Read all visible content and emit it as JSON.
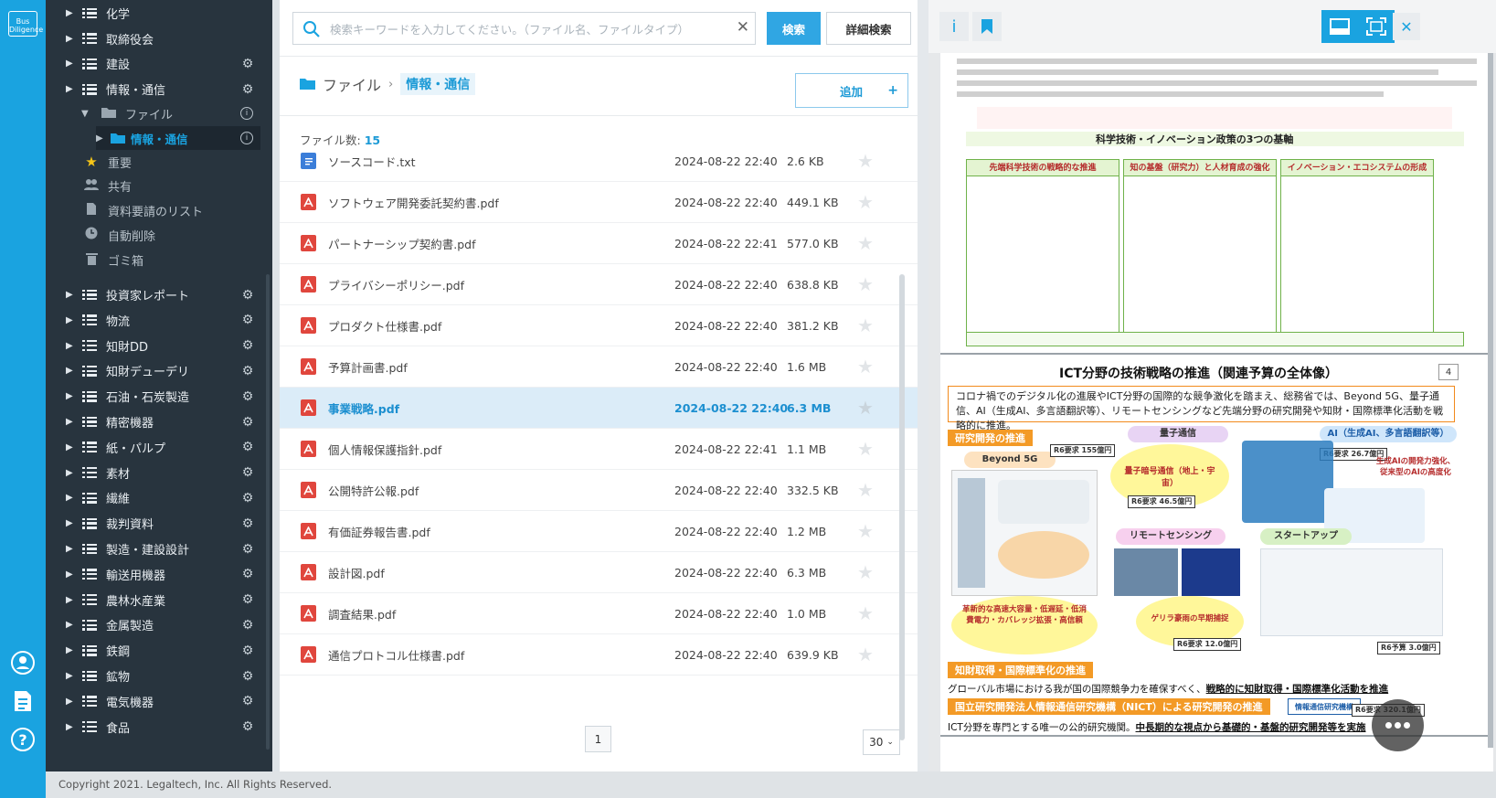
{
  "rail": {
    "logo_text": "Bus Diligence",
    "icons": [
      "user-icon",
      "document-icon",
      "help-icon"
    ]
  },
  "sidebar": {
    "items_top": [
      {
        "label": "化学",
        "gear": false
      },
      {
        "label": "取締役会",
        "gear": false
      },
      {
        "label": "建設",
        "gear": true
      },
      {
        "label": "情報・通信",
        "gear": true
      }
    ],
    "subfolder": {
      "label": "ファイル",
      "child": "情報・通信"
    },
    "special": [
      {
        "icon": "star-icon",
        "label": "重要"
      },
      {
        "icon": "people-icon",
        "label": "共有"
      },
      {
        "icon": "document-list-icon",
        "label": "資料要請のリスト"
      },
      {
        "icon": "clock-icon",
        "label": "自動削除"
      },
      {
        "icon": "trash-icon",
        "label": "ゴミ箱"
      }
    ],
    "items_bottom": [
      "投資家レポート",
      "物流",
      "知財DD",
      "知財デューデリ",
      "石油・石炭製造",
      "精密機器",
      "紙・パルプ",
      "素材",
      "繊維",
      "裁判資料",
      "製造・建設設計",
      "輸送用機器",
      "農林水産業",
      "金属製造",
      "鉄鋼",
      "鉱物",
      "電気機器",
      "食品"
    ]
  },
  "search": {
    "placeholder": "検索キーワードを入力してください。（ファイル名、ファイルタイプ）",
    "value": "",
    "clear_symbol": "✕",
    "search_label": "検索",
    "advanced_label": "詳細検索"
  },
  "breadcrumb": {
    "root": "ファイル",
    "separator": "›",
    "current": "情報・通信"
  },
  "add_button": {
    "label": "追加",
    "plus": "+"
  },
  "file_count": {
    "label": "ファイル数:",
    "value": "15"
  },
  "files": [
    {
      "type": "txt",
      "name": "ソースコード.txt",
      "date": "2024-08-22 22:40",
      "size": "2.6 KB",
      "selected": false
    },
    {
      "type": "pdf",
      "name": "ソフトウェア開発委託契約書.pdf",
      "date": "2024-08-22 22:40",
      "size": "449.1 KB",
      "selected": false
    },
    {
      "type": "pdf",
      "name": "パートナーシップ契約書.pdf",
      "date": "2024-08-22 22:41",
      "size": "577.0 KB",
      "selected": false
    },
    {
      "type": "pdf",
      "name": "プライバシーポリシー.pdf",
      "date": "2024-08-22 22:40",
      "size": "638.8 KB",
      "selected": false
    },
    {
      "type": "pdf",
      "name": "プロダクト仕様書.pdf",
      "date": "2024-08-22 22:40",
      "size": "381.2 KB",
      "selected": false
    },
    {
      "type": "pdf",
      "name": "予算計画書.pdf",
      "date": "2024-08-22 22:40",
      "size": "1.6 MB",
      "selected": false
    },
    {
      "type": "pdf",
      "name": "事業戦略.pdf",
      "date": "2024-08-22 22:40",
      "size": "6.3 MB",
      "selected": true
    },
    {
      "type": "pdf",
      "name": "個人情報保護指針.pdf",
      "date": "2024-08-22 22:41",
      "size": "1.1 MB",
      "selected": false
    },
    {
      "type": "pdf",
      "name": "公開特許公報.pdf",
      "date": "2024-08-22 22:40",
      "size": "332.5 KB",
      "selected": false
    },
    {
      "type": "pdf",
      "name": "有価証券報告書.pdf",
      "date": "2024-08-22 22:40",
      "size": "1.2 MB",
      "selected": false
    },
    {
      "type": "pdf",
      "name": "設計図.pdf",
      "date": "2024-08-22 22:40",
      "size": "6.3 MB",
      "selected": false
    },
    {
      "type": "pdf",
      "name": "調査結果.pdf",
      "date": "2024-08-22 22:40",
      "size": "1.0 MB",
      "selected": false
    },
    {
      "type": "pdf",
      "name": "通信プロトコル仕様書.pdf",
      "date": "2024-08-22 22:40",
      "size": "639.9 KB",
      "selected": false
    }
  ],
  "pagination": {
    "page": "1",
    "per_page": "30"
  },
  "viewer": {
    "toolbar": {
      "info": "i"
    },
    "page1": {
      "heading": "科学技術・イノベーション政策の3つの基軸",
      "columns": [
        "先端科学技術の戦略的な推進",
        "知の基盤（研究力）と人材育成の強化",
        "イノベーション・エコシステムの形成"
      ]
    },
    "page2": {
      "title": "ICT分野の技術戦略の推進（関連予算の全体像）",
      "page_number": "4",
      "lead": "コロナ禍でのデジタル化の進展やICT分野の国際的な競争激化を踏まえ、総務省では、Beyond 5G、量子通信、AI（生成AI、多言語翻訳等）、リモートセンシングなど先端分野の研究開発や知財・国際標準化活動を戦略的に推進。",
      "band_rd": "研究開発の推進",
      "pill_beyond": "Beyond 5G",
      "pill_quantum": "量子通信",
      "pill_ai": "AI（生成AI、多言語翻訳等）",
      "pill_remote": "リモートセンシング",
      "pill_startup": "スタートアップ",
      "budget_b5g": "R6要求 155億円",
      "budget_quantum": "R6要求 46.5億円",
      "budget_ai": "R6要求 26.7億円",
      "budget_remote": "R6要求 12.0億円",
      "budget_startup": "R6予算 3.0億円",
      "quantum_text": "量子暗号通信（地上・宇宙）",
      "ai_text": "生成AIの開発力強化、従来型のAIの高度化",
      "b5g_text": "革新的な高速大容量・低遅延・低消費電力・カバレッジ拡張・高信頼",
      "remote_text": "ゲリラ豪雨の早期捕捉",
      "band_ip": "知財取得・国際標準化の推進",
      "ip_text": "グローバル市場における我が国の国際競争力を確保すべく、",
      "ip_emph": "戦略的に知財取得・国際標準化活動を推進",
      "band_nict": "国立研究開発法人情報通信研究機構（NICT）による研究開発の推進",
      "nict_text": "ICT分野を専門とする唯一の公的研究機関。",
      "nict_emph": "中長期的な視点から基礎的・基盤的研究開発等を実施",
      "nict_logo": "情報通信研究機構",
      "budget_nict": "R6要求 320.1億円"
    }
  },
  "footer": {
    "copyright": "Copyright 2021. Legaltech, Inc. All Rights Reserved."
  },
  "colors": {
    "accent": "#1aa3e0",
    "sidebar_bg": "#28343e",
    "pdf_icon": "#e0463d",
    "selected_row": "#dbecf8"
  }
}
